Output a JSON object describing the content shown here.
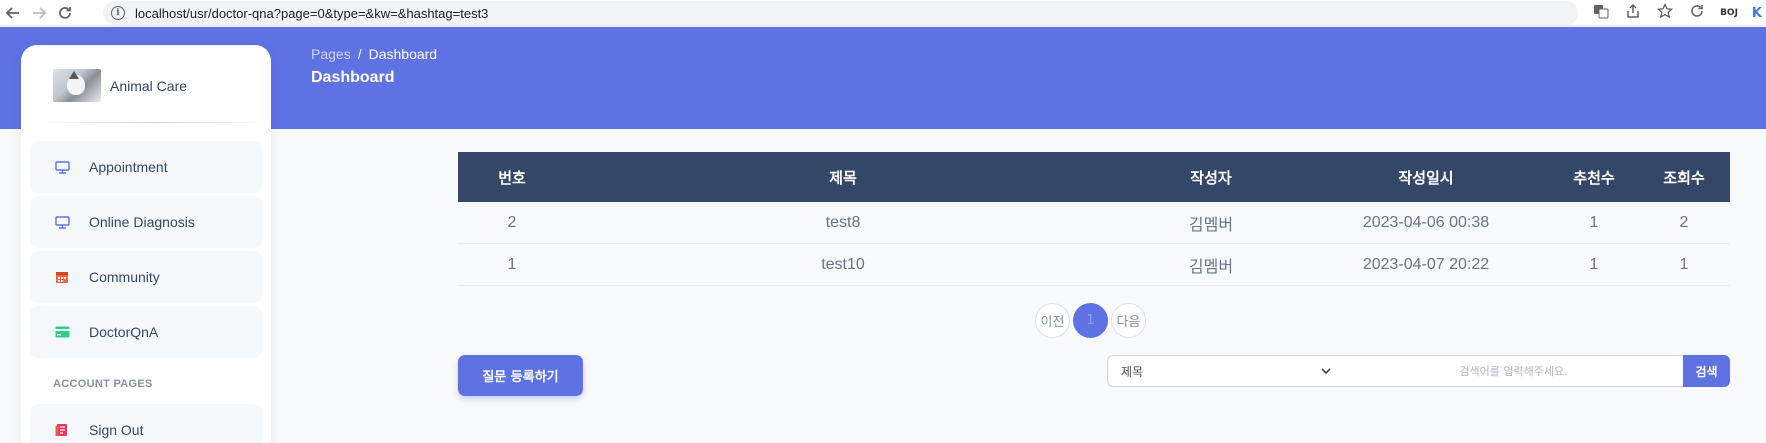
{
  "browser": {
    "url": "localhost/usr/doctor-qna?page=0&type=&kw=&hashtag=test3",
    "back_icon": "arrow-left",
    "forward_icon": "arrow-right",
    "reload_icon": "reload",
    "ext_label": "BOJ",
    "ext_k": "K"
  },
  "header": {
    "breadcrumb_root": "Pages",
    "breadcrumb_sep": "/",
    "breadcrumb_current": "Dashboard",
    "title": "Dashboard",
    "bg_color": "#5e72e4"
  },
  "sidebar": {
    "brand": "Animal Care",
    "items": [
      {
        "label": "Appointment",
        "icon": "monitor-icon"
      },
      {
        "label": "Online Diagnosis",
        "icon": "monitor-icon"
      },
      {
        "label": "Community",
        "icon": "calendar-icon"
      },
      {
        "label": "DoctorQnA",
        "icon": "credit-card-icon"
      }
    ],
    "section": "ACCOUNT PAGES",
    "account_items": [
      {
        "label": "Sign Out",
        "icon": "document-icon"
      }
    ]
  },
  "table": {
    "headers": [
      "번호",
      "제목",
      "작성자",
      "작성일시",
      "추천수",
      "조회수"
    ],
    "rows": [
      [
        "2",
        "test8",
        "김멤버",
        "2023-04-06 00:38",
        "1",
        "2"
      ],
      [
        "1",
        "test10",
        "김멤버",
        "2023-04-07 20:22",
        "1",
        "1"
      ]
    ]
  },
  "pagination": {
    "prev": "이전",
    "current": "1",
    "next": "다음"
  },
  "actions": {
    "write_label": "질문 등록하기"
  },
  "search": {
    "select_value": "제목",
    "placeholder": "검색어를 입력해주세요.",
    "button": "검색"
  }
}
